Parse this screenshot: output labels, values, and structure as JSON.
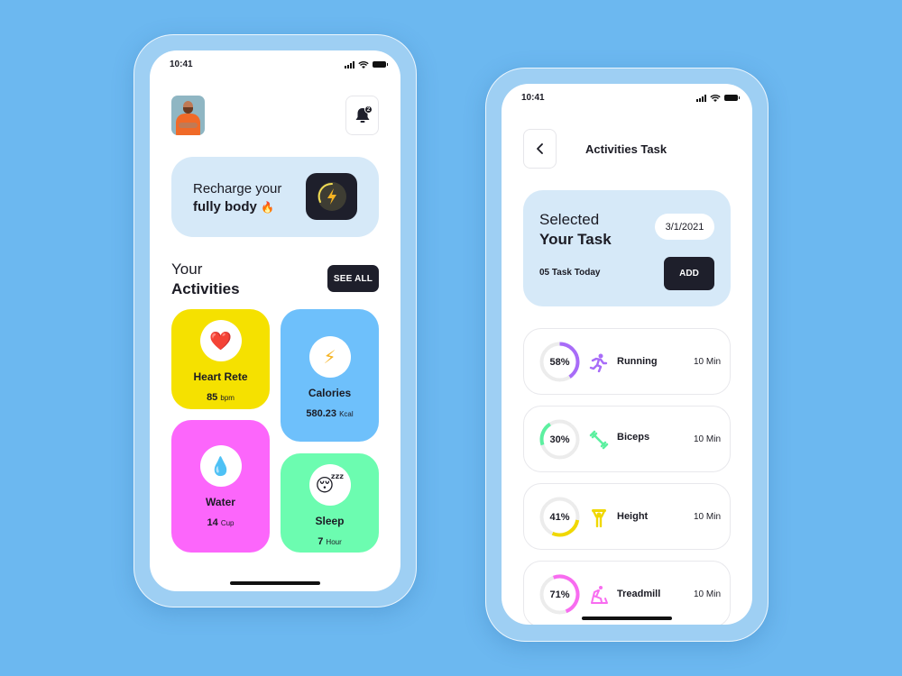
{
  "colors": {
    "background": "#6cb8f0",
    "dark": "#1e1f2b",
    "light_blue_card": "#d6e9f8",
    "heart_card": "#f5e100",
    "calories_card": "#6ec0fb",
    "water_card": "#fc66fb",
    "sleep_card": "#6cfcb0",
    "running": "#a86cf8",
    "biceps": "#5cf0a0",
    "height": "#f0d800",
    "treadmill": "#f86cf0",
    "ring_track": "#ececec"
  },
  "home_screen": {
    "status": {
      "time": "10:41"
    },
    "avatar": "user-avatar",
    "notifications": {
      "icon": "bell-icon",
      "count": "2"
    },
    "recharge": {
      "line1": "Recharge your",
      "line2": "fully body",
      "emoji": "🔥",
      "icon": "lightning-icon"
    },
    "section": {
      "title_line1": "Your",
      "title_line2": "Activities",
      "see_all": "SEE ALL"
    },
    "activities": [
      {
        "name": "Heart Rete",
        "value": "85",
        "unit": "bpm",
        "icon": "❤️",
        "icon_name": "heart-icon",
        "color": "#f5e100"
      },
      {
        "name": "Calories",
        "value": "580.23",
        "unit": "Kcal",
        "icon": "⚡",
        "icon_name": "lightning-icon",
        "color": "#6ec0fb"
      },
      {
        "name": "Water",
        "value": "14",
        "unit": "Cup",
        "icon": "💧",
        "icon_name": "water-drop-icon",
        "color": "#fc66fb"
      },
      {
        "name": "Sleep",
        "value": "7",
        "unit": "Hour",
        "icon": "😴",
        "icon_name": "sleep-icon",
        "color": "#6cfcb0"
      }
    ]
  },
  "task_screen": {
    "status": {
      "time": "10:41"
    },
    "title": "Activities Task",
    "selected": {
      "line1": "Selected",
      "line2": "Your Task",
      "date": "3/1/2021",
      "count": "05 Task Today",
      "add": "ADD"
    },
    "tasks": [
      {
        "name": "Running",
        "percent": 58,
        "percent_label": "58%",
        "duration": "10 Min",
        "icon_name": "running-icon",
        "color": "#a86cf8"
      },
      {
        "name": "Biceps",
        "percent": 30,
        "percent_label": "30%",
        "duration": "10 Min",
        "icon_name": "dumbbell-icon",
        "color": "#5cf0a0"
      },
      {
        "name": "Height",
        "percent": 41,
        "percent_label": "41%",
        "duration": "10 Min",
        "icon_name": "weightlifting-icon",
        "color": "#f0d800"
      },
      {
        "name": "Treadmill",
        "percent": 71,
        "percent_label": "71%",
        "duration": "10 Min",
        "icon_name": "treadmill-icon",
        "color": "#f86cf0"
      }
    ]
  }
}
